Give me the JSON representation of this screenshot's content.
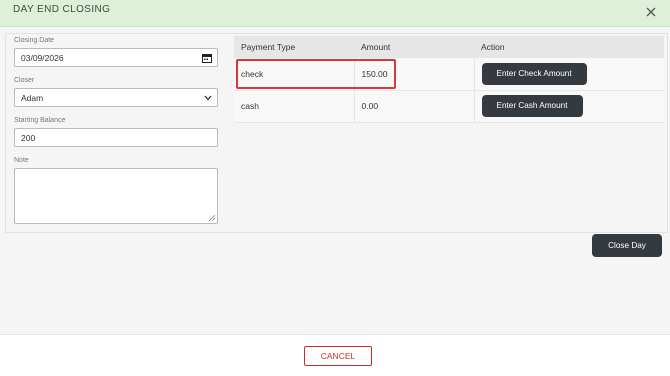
{
  "header": {
    "title": "DAY END CLOSING"
  },
  "form": {
    "closing_date": {
      "label": "Closing Date",
      "value": "03/09/2026"
    },
    "closer": {
      "label": "Closer",
      "value": "Adam"
    },
    "starting_balance": {
      "label": "Starting Balance",
      "value": "200"
    },
    "note": {
      "label": "Note",
      "value": ""
    }
  },
  "table": {
    "headers": [
      "Payment Type",
      "Amount",
      "Action"
    ],
    "rows": [
      {
        "type": "check",
        "amount": "150.00",
        "action": "Enter Check Amount"
      },
      {
        "type": "cash",
        "amount": "0.00",
        "action": "Enter Cash Amount"
      }
    ]
  },
  "actions": {
    "close_day": "Close Day",
    "cancel": "CANCEL"
  },
  "colors": {
    "header_bg": "#dff0d8",
    "dark_button": "#343a40",
    "highlight": "#d9363e",
    "cancel": "#c9302c"
  }
}
